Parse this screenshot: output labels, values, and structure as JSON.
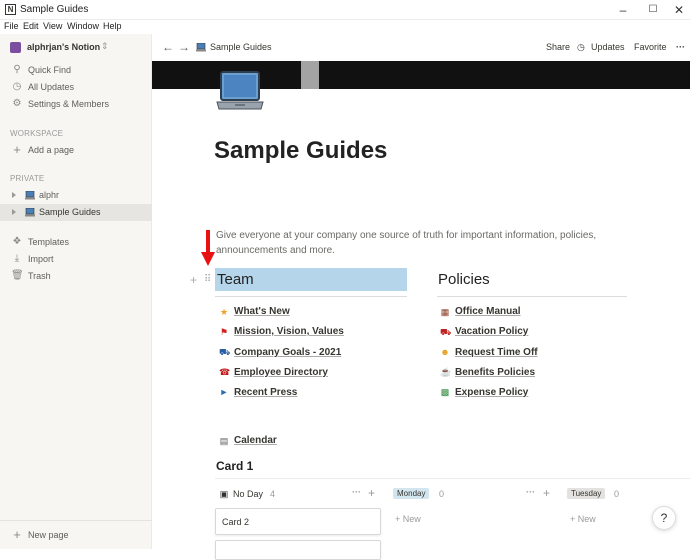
{
  "window": {
    "title": "Sample Guides"
  },
  "menu": [
    "File",
    "Edit",
    "View",
    "Window",
    "Help"
  ],
  "sidebar": {
    "workspace": "alphrjan's Notion",
    "quick": [
      {
        "label": "Quick Find",
        "icon": "search-icon"
      },
      {
        "label": "All Updates",
        "icon": "clock-icon"
      },
      {
        "label": "Settings & Members",
        "icon": "gear-icon"
      }
    ],
    "workspace_section": "WORKSPACE",
    "add_page": "Add a page",
    "private_section": "PRIVATE",
    "pages": [
      {
        "label": "alphr",
        "icon": "laptop-icon"
      },
      {
        "label": "Sample Guides",
        "icon": "laptop-icon",
        "selected": true
      }
    ],
    "tools": [
      {
        "label": "Templates",
        "icon": "templates-icon"
      },
      {
        "label": "Import",
        "icon": "import-icon"
      },
      {
        "label": "Trash",
        "icon": "trash-icon"
      }
    ],
    "new_page": "New page"
  },
  "topbar": {
    "breadcrumb": "Sample Guides",
    "share": "Share",
    "updates": "Updates",
    "favorite": "Favorite",
    "more": "···"
  },
  "page": {
    "title": "Sample Guides",
    "description": "Give everyone at your company one source of truth for important information, policies, announcements and more.",
    "team": {
      "heading": "Team",
      "items": [
        {
          "label": "What's New",
          "icon": "star-icon"
        },
        {
          "label": "Mission, Vision, Values",
          "icon": "flag-icon"
        },
        {
          "label": "Company Goals - 2021",
          "icon": "car-icon"
        },
        {
          "label": "Employee Directory",
          "icon": "phone-icon"
        },
        {
          "label": "Recent Press",
          "icon": "megaphone-icon"
        }
      ]
    },
    "policies": {
      "heading": "Policies",
      "items": [
        {
          "label": "Office Manual",
          "icon": "book-icon"
        },
        {
          "label": "Vacation Policy",
          "icon": "car-icon"
        },
        {
          "label": "Request Time Off",
          "icon": "face-icon"
        },
        {
          "label": "Benefits Policies",
          "icon": "coffee-icon"
        },
        {
          "label": "Expense Policy",
          "icon": "money-icon"
        }
      ]
    },
    "calendar": "Calendar",
    "board": {
      "title": "Card 1",
      "columns": [
        {
          "label": "No Day",
          "count": "4",
          "card": "Card 2"
        },
        {
          "label": "Monday",
          "count": "0",
          "new": "+ New",
          "color": "#d3e5ef"
        },
        {
          "label": "Tuesday",
          "count": "0",
          "new": "+ New",
          "color": "#e3e2e0"
        }
      ]
    }
  },
  "help": "?"
}
